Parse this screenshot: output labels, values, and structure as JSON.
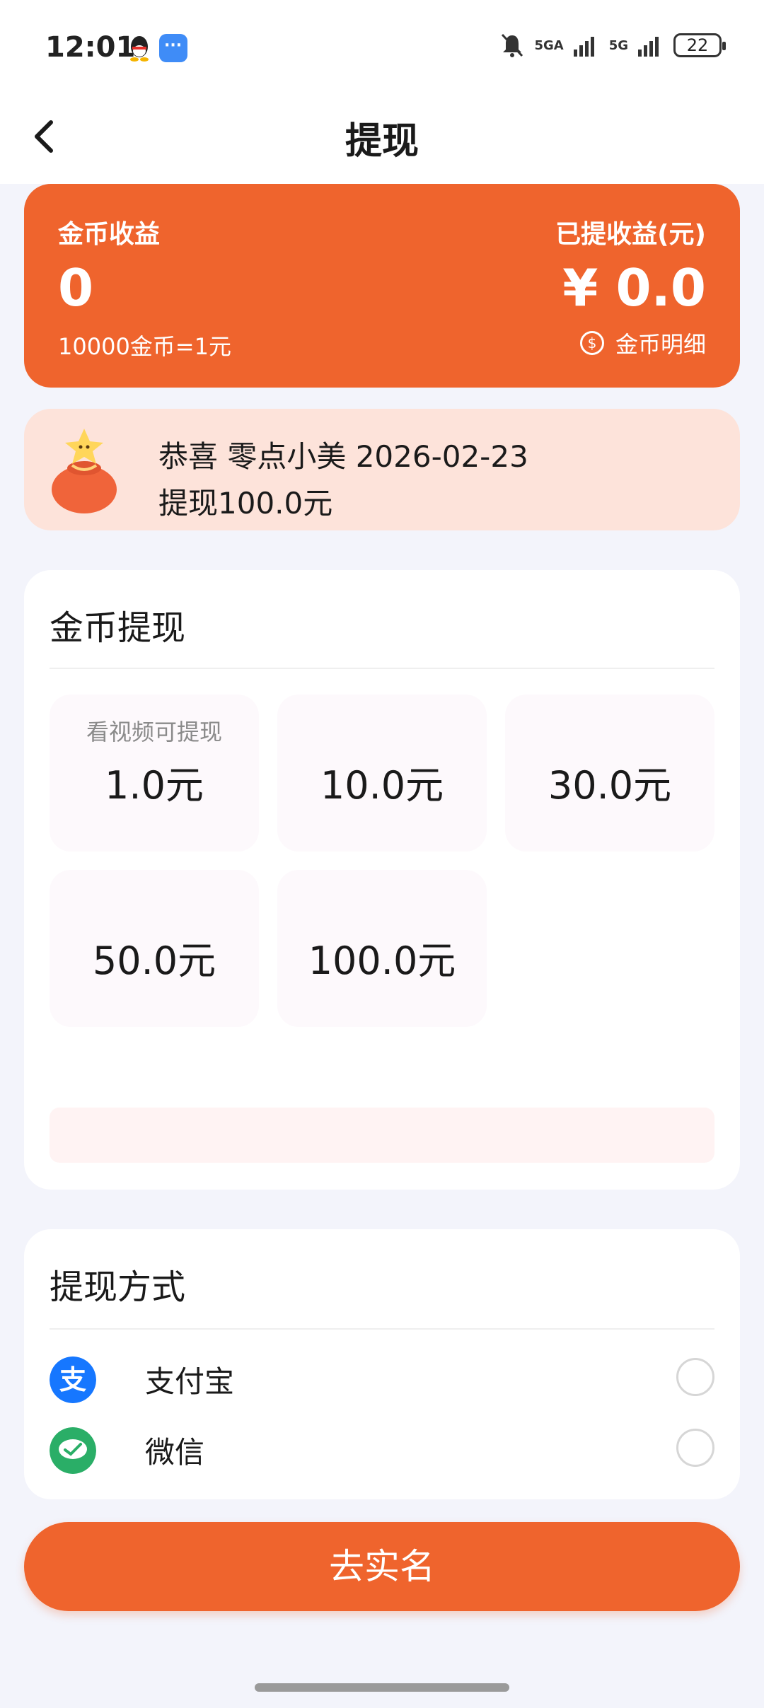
{
  "status_bar": {
    "time": "12:01",
    "signal1": "5GA",
    "signal2": "5G",
    "battery": "22",
    "icons": [
      "qq-icon",
      "message-icon",
      "mute-bell-icon",
      "signal-icon",
      "signal-icon",
      "battery-icon"
    ]
  },
  "header": {
    "title": "提现",
    "back_icon": "chevron-left-icon"
  },
  "earnings": {
    "coin_label": "金币收益",
    "coin_value": "0",
    "rate": "10000金币=1元",
    "withdrawn_label": "已提收益(元)",
    "withdrawn_value": "¥ 0.0",
    "detail_link": "金币明细",
    "accent_color": "#ef642d"
  },
  "notice": {
    "line1": "恭喜 零点小美 2026-02-23",
    "line2": "提现100.0元",
    "icon": "money-bag-icon"
  },
  "withdraw": {
    "title": "金币提现",
    "options": [
      {
        "tag": "看视频可提现",
        "amount": "1.0元"
      },
      {
        "tag": "",
        "amount": "10.0元"
      },
      {
        "tag": "",
        "amount": "30.0元"
      },
      {
        "tag": "",
        "amount": "50.0元"
      },
      {
        "tag": "",
        "amount": "100.0元"
      }
    ]
  },
  "methods": {
    "title": "提现方式",
    "items": [
      {
        "label": "支付宝",
        "icon": "alipay-icon",
        "color": "#1677ff"
      },
      {
        "label": "微信",
        "icon": "wechat-icon",
        "color": "#2aae67"
      }
    ]
  },
  "cta": {
    "label": "去实名"
  }
}
